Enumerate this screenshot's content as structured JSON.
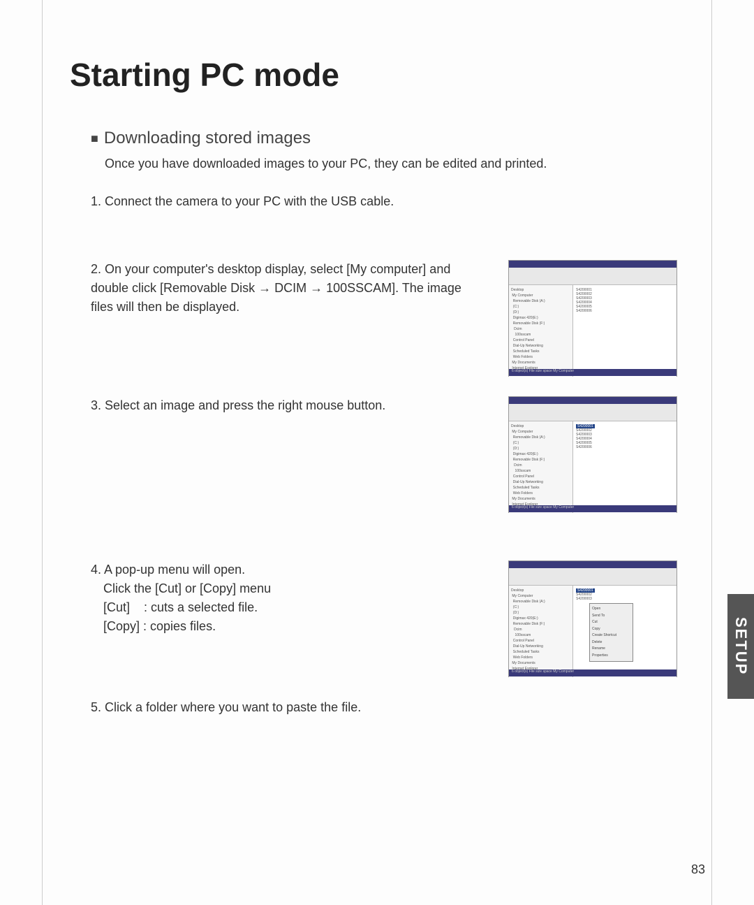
{
  "title": "Starting PC mode",
  "subheading": "Downloading stored images",
  "intro": "Once you have downloaded images to your PC, they can be edited and printed.",
  "steps": {
    "s1": "1. Connect the camera to your PC with the USB cable.",
    "s2": "2. On your computer's desktop display, select [My computer] and double click [Removable Disk → DCIM → 100SSCAM]. The image files will then be displayed.",
    "s3": "3. Select an image and press the right mouse button.",
    "s4a": "4. A pop-up menu will open.",
    "s4b": "Click the [Cut] or [Copy] menu",
    "s4c": "[Cut]    : cuts a selected file.",
    "s4d": "[Copy] : copies files.",
    "s5": "5. Click a folder where you want to paste the file."
  },
  "tab": "SETUP",
  "page_number": "83",
  "thumb_labels": {
    "tree": "Desktop\n My Computer\n  Removable Disk (A:)\n  (C:)\n  (D:)\n  Digimax 420(E:)\n  Removable Disk (F:)\n   Dcim\n    100sscam\n  Control Panel\n  Dial-Up Networking\n  Scheduled Tasks\n  Web Folders\n My Documents\n Internet Explorer\n Network Neighborhood\n Recycle Bin",
    "files": "S4200001\nS4200002\nS4200003\nS4200004\nS4200005\nS4200006",
    "status": "6 object(s)  File size space   My Computer",
    "ctx": "Open\nSend To\nCut\nCopy\nCreate Shortcut\nDelete\nRename\nProperties"
  }
}
